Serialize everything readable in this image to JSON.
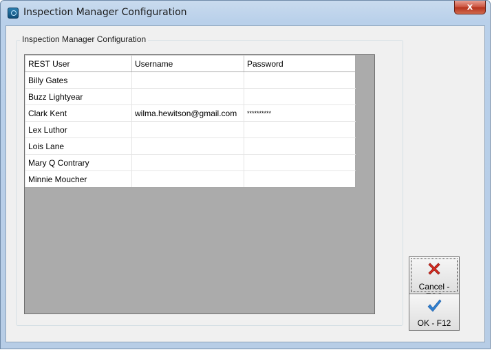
{
  "window": {
    "title": "Inspection Manager Configuration",
    "close_glyph": "x"
  },
  "group": {
    "title": "Inspection Manager Configuration"
  },
  "table": {
    "columns": [
      "REST User",
      "Username",
      "Password"
    ],
    "rows": [
      [
        "Billy Gates",
        "",
        ""
      ],
      [
        "Buzz Lightyear",
        "",
        ""
      ],
      [
        "Clark Kent",
        "wilma.hewitson@gmail.com",
        "**********"
      ],
      [
        "Lex Luthor",
        "",
        ""
      ],
      [
        "Lois Lane",
        "",
        ""
      ],
      [
        "Mary Q Contrary",
        "",
        ""
      ],
      [
        "Minnie Moucher",
        "",
        ""
      ]
    ]
  },
  "buttons": {
    "cancel_label": "Cancel - ESC",
    "cancel_icon": "red-x-icon",
    "ok_label": "OK - F12",
    "ok_icon": "blue-checkmark-icon"
  },
  "colors": {
    "cancel_icon": "#d92b20",
    "ok_icon": "#2f7fd1",
    "grid_background": "#ababab"
  }
}
